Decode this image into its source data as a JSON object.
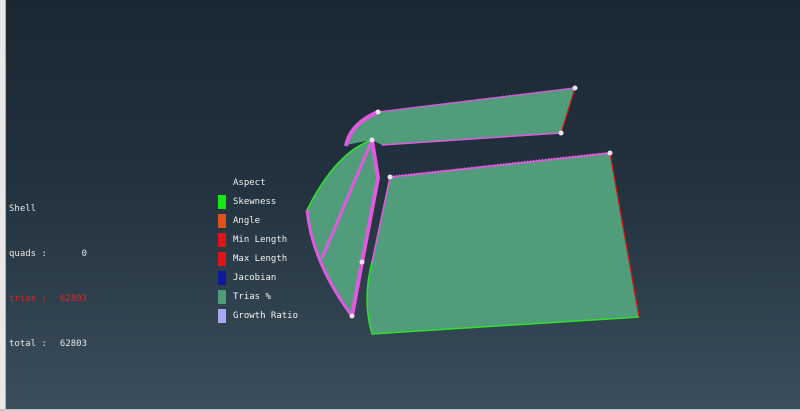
{
  "stats": {
    "title": "Shell",
    "rows": [
      {
        "label": "quads :",
        "value": "0"
      },
      {
        "label": "trias :",
        "value": "62803"
      },
      {
        "label": "total :",
        "value": "62803"
      }
    ]
  },
  "legend": {
    "title": "Aspect",
    "items": [
      {
        "label": "Skewness",
        "color": "#17e617"
      },
      {
        "label": "Angle",
        "color": "#e0521c"
      },
      {
        "label": "Min Length",
        "color": "#e01414"
      },
      {
        "label": "Max Length",
        "color": "#e01414"
      },
      {
        "label": "Jacobian",
        "color": "#0c1a9a"
      },
      {
        "label": "Trias %",
        "color": "#4f9a78"
      },
      {
        "label": "Growth Ratio",
        "color": "#a9a9f2"
      }
    ]
  },
  "colors": {
    "mesh_fill": "#4f9a78",
    "free_edge": "#e05ae0",
    "boundary_green": "#2fe02f",
    "boundary_red": "#e01414"
  }
}
